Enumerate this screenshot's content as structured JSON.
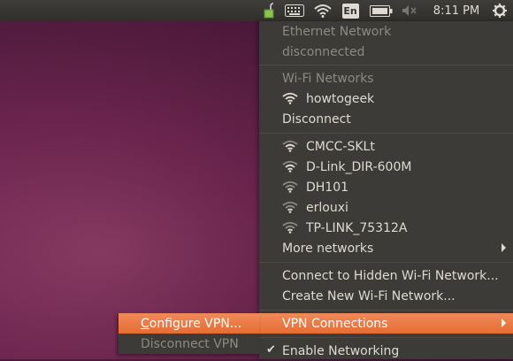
{
  "panel": {
    "time": "8:11 PM",
    "keyboard_layout": "En",
    "icons": [
      "network-manager-icon",
      "keyboard-icon",
      "wifi-icon",
      "keyboard-layout-icon",
      "battery-icon",
      "volume-muted-icon",
      "gear-icon"
    ]
  },
  "menu": {
    "ethernet_header": "Ethernet Network",
    "ethernet_status": "disconnected",
    "wifi_header": "Wi-Fi Networks",
    "connected_network": "howtogeek",
    "disconnect": "Disconnect",
    "networks": [
      "CMCC-SKLt",
      "D-Link_DIR-600M",
      "DH101",
      "erlouxi",
      "TP-LINK_75312A"
    ],
    "more_networks": "More networks",
    "connect_hidden": "Connect to Hidden Wi-Fi Network...",
    "create_new": "Create New Wi-Fi Network...",
    "vpn_connections": "VPN Connections",
    "enable_networking": "Enable Networking",
    "enable_networking_checked": "✔"
  },
  "submenu": {
    "configure_vpn_accel": "C",
    "configure_vpn_rest": "onfigure VPN...",
    "disconnect_vpn": "Disconnect VPN"
  },
  "colors": {
    "menu_bg": "#3c3b37",
    "highlight": "#e96f3a",
    "panel_bg": "#3a3935",
    "text": "#dfdbd2",
    "disabled_text": "#8d8a83"
  }
}
